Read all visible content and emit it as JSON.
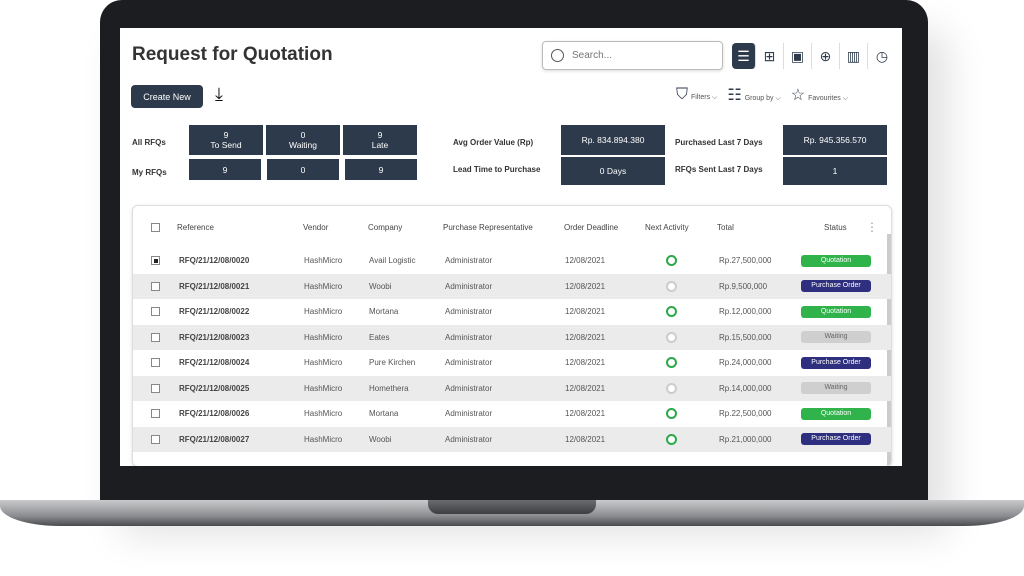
{
  "page": {
    "title": "Request for Quotation"
  },
  "search": {
    "placeholder": "Search..."
  },
  "views": [
    {
      "icon": "list-icon",
      "active": true
    },
    {
      "icon": "kanban-icon"
    },
    {
      "icon": "calendar-icon"
    },
    {
      "icon": "pivot-icon"
    },
    {
      "icon": "graph-icon"
    },
    {
      "icon": "activity-clock-icon"
    }
  ],
  "toolbar": {
    "create_label": "Create New",
    "filters": "Filters",
    "group_by": "Group by",
    "favourites": "Favourites"
  },
  "stats": {
    "all_label": "All RFQs",
    "my_label": "My RFQs",
    "all": [
      {
        "n": "9",
        "l": "To Send"
      },
      {
        "n": "0",
        "l": "Waiting"
      },
      {
        "n": "9",
        "l": "Late"
      }
    ],
    "my": [
      "9",
      "0",
      "9"
    ],
    "avg_label": "Avg Order Value (Rp)",
    "avg": "Rp. 834.894.380",
    "lead_label": "Lead Time to Purchase",
    "lead": "0 Days",
    "purchased_label": "Purchased Last 7 Days",
    "purchased": "Rp. 945.356.570",
    "sent_label": "RFQs Sent Last 7 Days",
    "sent": "1"
  },
  "colors": {
    "primary": "#2d3a4b",
    "quotation": "#2fb34a",
    "purchase_order": "#2e2f7f",
    "waiting": "#cfcfcf"
  },
  "table": {
    "headers": [
      "Reference",
      "Vendor",
      "Company",
      "Purchase Representative",
      "Order Deadline",
      "Next Activity",
      "Total",
      "Status"
    ],
    "rows": [
      {
        "ref": "RFQ/21/12/08/0020",
        "vendor": "HashMicro",
        "company": "Avail Logistic",
        "rep": "Administrator",
        "deadline": "12/08/2021",
        "activity": true,
        "total": "Rp.27,500,000",
        "status": "Quotation",
        "checked": true
      },
      {
        "ref": "RFQ/21/12/08/0021",
        "vendor": "HashMicro",
        "company": "Woobi",
        "rep": "Administrator",
        "deadline": "12/08/2021",
        "activity": false,
        "total": "Rp.9,500,000",
        "status": "Purchase Order"
      },
      {
        "ref": "RFQ/21/12/08/0022",
        "vendor": "HashMicro",
        "company": "Mortana",
        "rep": "Administrator",
        "deadline": "12/08/2021",
        "activity": true,
        "total": "Rp.12,000,000",
        "status": "Quotation"
      },
      {
        "ref": "RFQ/21/12/08/0023",
        "vendor": "HashMicro",
        "company": "Eates",
        "rep": "Administrator",
        "deadline": "12/08/2021",
        "activity": false,
        "total": "Rp.15,500,000",
        "status": "Waiting"
      },
      {
        "ref": "RFQ/21/12/08/0024",
        "vendor": "HashMicro",
        "company": "Pure Kirchen",
        "rep": "Administrator",
        "deadline": "12/08/2021",
        "activity": true,
        "total": "Rp.24,000,000",
        "status": "Purchase Order"
      },
      {
        "ref": "RFQ/21/12/08/0025",
        "vendor": "HashMicro",
        "company": "Homethera",
        "rep": "Administrator",
        "deadline": "12/08/2021",
        "activity": false,
        "total": "Rp.14,000,000",
        "status": "Waiting"
      },
      {
        "ref": "RFQ/21/12/08/0026",
        "vendor": "HashMicro",
        "company": "Mortana",
        "rep": "Administrator",
        "deadline": "12/08/2021",
        "activity": true,
        "total": "Rp.22,500,000",
        "status": "Quotation"
      },
      {
        "ref": "RFQ/21/12/08/0027",
        "vendor": "HashMicro",
        "company": "Woobi",
        "rep": "Administrator",
        "deadline": "12/08/2021",
        "activity": true,
        "total": "Rp.21,000,000",
        "status": "Purchase Order"
      }
    ]
  }
}
